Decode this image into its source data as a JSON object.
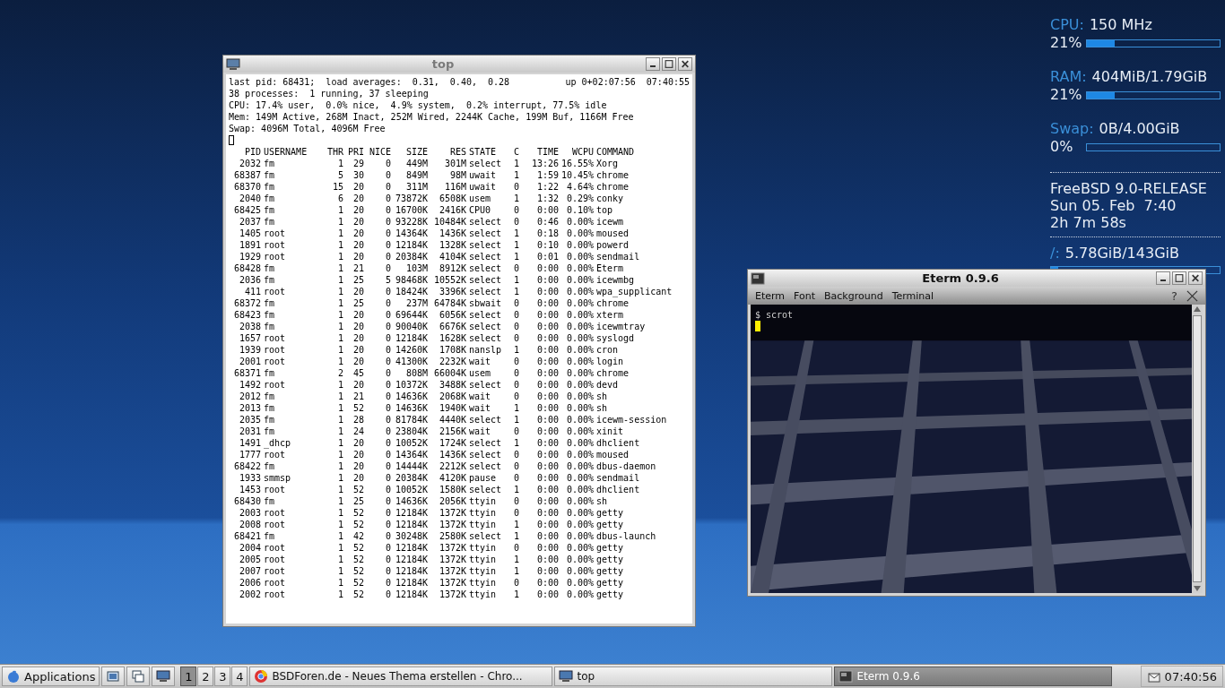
{
  "conky": {
    "meters": [
      {
        "label": "CPU:",
        "value": "150 MHz",
        "percent": "21%",
        "level": 0.21
      },
      {
        "label": "RAM:",
        "value": "404MiB/1.79GiB",
        "percent": "21%",
        "level": 0.21
      },
      {
        "label": "Swap:",
        "value": "0B/4.00GiB",
        "percent": "0%",
        "level": 0
      }
    ],
    "system_info": [
      "FreeBSD 9.0-RELEASE",
      "Sun 05. Feb  7:40",
      "2h 7m 58s"
    ],
    "disk": {
      "label": "/:",
      "value": "5.78GiB/143GiB",
      "level": 0.04
    }
  },
  "top_window": {
    "title": "top",
    "load": "last pid: 68431;  load averages:  0.31,  0.40,  0.28",
    "uptime": "up 0+02:07:56  07:40:55",
    "summary": [
      "38 processes:  1 running, 37 sleeping",
      "CPU: 17.4% user,  0.0% nice,  4.9% system,  0.2% interrupt, 77.5% idle",
      "Mem: 149M Active, 268M Inact, 252M Wired, 2244K Cache, 199M Buf, 1166M Free",
      "Swap: 4096M Total, 4096M Free"
    ],
    "columns": [
      "PID",
      "USERNAME",
      "THR",
      "PRI",
      "NICE",
      "SIZE",
      "RES",
      "STATE",
      "C",
      "TIME",
      "WCPU",
      "COMMAND"
    ],
    "rows": [
      [
        "2032",
        "fm",
        "1",
        "29",
        "0",
        "449M",
        "301M",
        "select",
        "1",
        "13:26",
        "16.55%",
        "Xorg"
      ],
      [
        "68387",
        "fm",
        "5",
        "30",
        "0",
        "849M",
        "98M",
        "uwait",
        "1",
        "1:59",
        "10.45%",
        "chrome"
      ],
      [
        "68370",
        "fm",
        "15",
        "20",
        "0",
        "311M",
        "116M",
        "uwait",
        "0",
        "1:22",
        "4.64%",
        "chrome"
      ],
      [
        "2040",
        "fm",
        "6",
        "20",
        "0",
        "73872K",
        "6508K",
        "usem",
        "1",
        "1:32",
        "0.29%",
        "conky"
      ],
      [
        "68425",
        "fm",
        "1",
        "20",
        "0",
        "16700K",
        "2416K",
        "CPU0",
        "0",
        "0:00",
        "0.10%",
        "top"
      ],
      [
        "2037",
        "fm",
        "1",
        "20",
        "0",
        "93228K",
        "10484K",
        "select",
        "0",
        "0:46",
        "0.00%",
        "icewm"
      ],
      [
        "1405",
        "root",
        "1",
        "20",
        "0",
        "14364K",
        "1436K",
        "select",
        "1",
        "0:18",
        "0.00%",
        "moused"
      ],
      [
        "1891",
        "root",
        "1",
        "20",
        "0",
        "12184K",
        "1328K",
        "select",
        "1",
        "0:10",
        "0.00%",
        "powerd"
      ],
      [
        "1929",
        "root",
        "1",
        "20",
        "0",
        "20384K",
        "4104K",
        "select",
        "1",
        "0:01",
        "0.00%",
        "sendmail"
      ],
      [
        "68428",
        "fm",
        "1",
        "21",
        "0",
        "103M",
        "8912K",
        "select",
        "0",
        "0:00",
        "0.00%",
        "Eterm"
      ],
      [
        "2036",
        "fm",
        "1",
        "25",
        "5",
        "98468K",
        "10552K",
        "select",
        "1",
        "0:00",
        "0.00%",
        "icewmbg"
      ],
      [
        "411",
        "root",
        "1",
        "20",
        "0",
        "18424K",
        "3396K",
        "select",
        "1",
        "0:00",
        "0.00%",
        "wpa_supplicant"
      ],
      [
        "68372",
        "fm",
        "1",
        "25",
        "0",
        "237M",
        "64784K",
        "sbwait",
        "0",
        "0:00",
        "0.00%",
        "chrome"
      ],
      [
        "68423",
        "fm",
        "1",
        "20",
        "0",
        "69644K",
        "6056K",
        "select",
        "0",
        "0:00",
        "0.00%",
        "xterm"
      ],
      [
        "2038",
        "fm",
        "1",
        "20",
        "0",
        "90040K",
        "6676K",
        "select",
        "0",
        "0:00",
        "0.00%",
        "icewmtray"
      ],
      [
        "1657",
        "root",
        "1",
        "20",
        "0",
        "12184K",
        "1628K",
        "select",
        "0",
        "0:00",
        "0.00%",
        "syslogd"
      ],
      [
        "1939",
        "root",
        "1",
        "20",
        "0",
        "14260K",
        "1708K",
        "nanslp",
        "1",
        "0:00",
        "0.00%",
        "cron"
      ],
      [
        "2001",
        "root",
        "1",
        "20",
        "0",
        "41300K",
        "2232K",
        "wait",
        "0",
        "0:00",
        "0.00%",
        "login"
      ],
      [
        "68371",
        "fm",
        "2",
        "45",
        "0",
        "808M",
        "66004K",
        "usem",
        "0",
        "0:00",
        "0.00%",
        "chrome"
      ],
      [
        "1492",
        "root",
        "1",
        "20",
        "0",
        "10372K",
        "3488K",
        "select",
        "0",
        "0:00",
        "0.00%",
        "devd"
      ],
      [
        "2012",
        "fm",
        "1",
        "21",
        "0",
        "14636K",
        "2068K",
        "wait",
        "0",
        "0:00",
        "0.00%",
        "sh"
      ],
      [
        "2013",
        "fm",
        "1",
        "52",
        "0",
        "14636K",
        "1940K",
        "wait",
        "1",
        "0:00",
        "0.00%",
        "sh"
      ],
      [
        "2035",
        "fm",
        "1",
        "28",
        "0",
        "81784K",
        "4440K",
        "select",
        "1",
        "0:00",
        "0.00%",
        "icewm-session"
      ],
      [
        "2031",
        "fm",
        "1",
        "24",
        "0",
        "23804K",
        "2156K",
        "wait",
        "0",
        "0:00",
        "0.00%",
        "xinit"
      ],
      [
        "1491",
        "_dhcp",
        "1",
        "20",
        "0",
        "10052K",
        "1724K",
        "select",
        "1",
        "0:00",
        "0.00%",
        "dhclient"
      ],
      [
        "1777",
        "root",
        "1",
        "20",
        "0",
        "14364K",
        "1436K",
        "select",
        "0",
        "0:00",
        "0.00%",
        "moused"
      ],
      [
        "68422",
        "fm",
        "1",
        "20",
        "0",
        "14444K",
        "2212K",
        "select",
        "0",
        "0:00",
        "0.00%",
        "dbus-daemon"
      ],
      [
        "1933",
        "smmsp",
        "1",
        "20",
        "0",
        "20384K",
        "4120K",
        "pause",
        "0",
        "0:00",
        "0.00%",
        "sendmail"
      ],
      [
        "1453",
        "root",
        "1",
        "52",
        "0",
        "10052K",
        "1580K",
        "select",
        "1",
        "0:00",
        "0.00%",
        "dhclient"
      ],
      [
        "68430",
        "fm",
        "1",
        "25",
        "0",
        "14636K",
        "2056K",
        "ttyin",
        "0",
        "0:00",
        "0.00%",
        "sh"
      ],
      [
        "2003",
        "root",
        "1",
        "52",
        "0",
        "12184K",
        "1372K",
        "ttyin",
        "0",
        "0:00",
        "0.00%",
        "getty"
      ],
      [
        "2008",
        "root",
        "1",
        "52",
        "0",
        "12184K",
        "1372K",
        "ttyin",
        "1",
        "0:00",
        "0.00%",
        "getty"
      ],
      [
        "68421",
        "fm",
        "1",
        "42",
        "0",
        "30248K",
        "2580K",
        "select",
        "1",
        "0:00",
        "0.00%",
        "dbus-launch"
      ],
      [
        "2004",
        "root",
        "1",
        "52",
        "0",
        "12184K",
        "1372K",
        "ttyin",
        "0",
        "0:00",
        "0.00%",
        "getty"
      ],
      [
        "2005",
        "root",
        "1",
        "52",
        "0",
        "12184K",
        "1372K",
        "ttyin",
        "1",
        "0:00",
        "0.00%",
        "getty"
      ],
      [
        "2007",
        "root",
        "1",
        "52",
        "0",
        "12184K",
        "1372K",
        "ttyin",
        "1",
        "0:00",
        "0.00%",
        "getty"
      ],
      [
        "2006",
        "root",
        "1",
        "52",
        "0",
        "12184K",
        "1372K",
        "ttyin",
        "0",
        "0:00",
        "0.00%",
        "getty"
      ],
      [
        "2002",
        "root",
        "1",
        "52",
        "0",
        "12184K",
        "1372K",
        "ttyin",
        "1",
        "0:00",
        "0.00%",
        "getty"
      ]
    ]
  },
  "eterm_window": {
    "title": "Eterm 0.9.6",
    "menu": [
      "Eterm",
      "Font",
      "Background",
      "Terminal"
    ],
    "help": "?",
    "lines": [
      "$ scrot"
    ]
  },
  "taskbar": {
    "start": "Applications",
    "workspaces": [
      {
        "label": "1",
        "selected": true
      },
      {
        "label": "2",
        "selected": false
      },
      {
        "label": "3",
        "selected": false
      },
      {
        "label": "4",
        "selected": false
      }
    ],
    "tasks": [
      {
        "label": "BSDForen.de - Neues Thema erstellen - Chro...",
        "kind": "browser",
        "selected": false
      },
      {
        "label": "top",
        "kind": "terminal",
        "selected": false
      },
      {
        "label": "Eterm 0.9.6",
        "kind": "eterm",
        "selected": true
      }
    ],
    "clock": "07:40:56"
  }
}
